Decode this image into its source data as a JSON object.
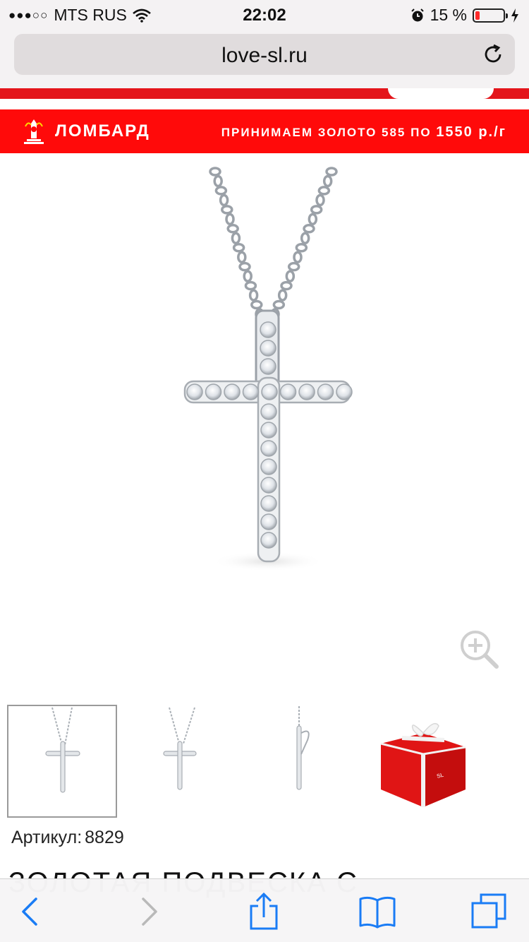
{
  "status_bar": {
    "signal_dots": "●●●○○",
    "carrier": "MTS RUS",
    "time": "22:02",
    "battery_percent_label": "15 %",
    "battery_level": 0.15,
    "icons": [
      "wifi-icon",
      "alarm-icon",
      "battery-icon",
      "charging-icon"
    ]
  },
  "browser": {
    "url": "love-sl.ru",
    "reload_icon": "reload-icon"
  },
  "banner": {
    "title": "ЛОМБАРД",
    "offer_prefix": "ПРИНИМАЕМ ЗОЛОТО 585 ПО",
    "offer_price": "1550 р./г",
    "background_color": "#ff0a0a"
  },
  "product": {
    "main_image": "cross-pendant-image",
    "zoom_icon": "zoom-in-icon",
    "thumbnails": [
      {
        "name": "thumbnail-front",
        "selected": true
      },
      {
        "name": "thumbnail-angle",
        "selected": false
      },
      {
        "name": "thumbnail-side",
        "selected": false
      },
      {
        "name": "thumbnail-gift-box",
        "selected": false
      }
    ],
    "sku_label": "Артикул:",
    "sku_value": "8829",
    "title": "ЗОЛОТАЯ ПОДВЕСКА С"
  },
  "toolbar": {
    "buttons": [
      "back-icon",
      "forward-icon",
      "share-icon",
      "bookmarks-icon",
      "tabs-icon"
    ],
    "accent_color": "#1a7cf5"
  }
}
